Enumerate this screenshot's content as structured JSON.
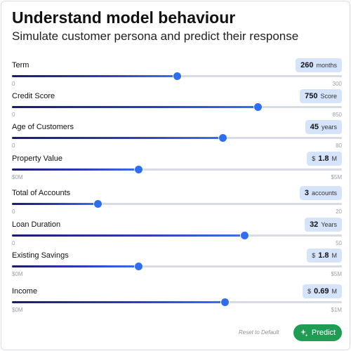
{
  "header": {
    "title": "Understand model behaviour",
    "subtitle": "Simulate customer persona and predict their response"
  },
  "sliders": [
    {
      "label": "Term",
      "prefix": "",
      "value": "260",
      "unit": "months",
      "min": "0",
      "max": "300",
      "level": 0.5
    },
    {
      "label": "Credit Score",
      "prefix": "",
      "value": "750",
      "unit": "Score",
      "min": "0",
      "max": "850",
      "level": 0.745
    },
    {
      "label": "Age of Customers",
      "prefix": "",
      "value": "45",
      "unit": "years",
      "min": "0",
      "max": "80",
      "level": 0.64
    },
    {
      "label": "Property Value",
      "prefix": "$",
      "value": "1.8",
      "unit": "M",
      "min": "$0M",
      "max": "$5M",
      "level": 0.385
    },
    {
      "label": "Total of Accounts",
      "prefix": "",
      "value": "3",
      "unit": "accounts",
      "min": "0",
      "max": "20",
      "level": 0.26
    },
    {
      "label": "Loan Duration",
      "prefix": "",
      "value": "32",
      "unit": "Years",
      "min": "0",
      "max": "50",
      "level": 0.705
    },
    {
      "label": "Existing Savings",
      "prefix": "$",
      "value": "1.8",
      "unit": "M",
      "min": "$0M",
      "max": "$5M",
      "level": 0.385
    },
    {
      "label": "Income",
      "prefix": "$",
      "value": "0.69",
      "unit": "M",
      "min": "$0M",
      "max": "$1M",
      "level": 0.645
    }
  ],
  "footer": {
    "reset_label": "Reset to Default",
    "predict_label": "Predict"
  },
  "colors": {
    "accent": "#2e6ef2",
    "pill_bg": "#d6e4fb",
    "predict_bg": "#1f9d55"
  },
  "icons": {
    "predict": "sparkle-icon"
  }
}
